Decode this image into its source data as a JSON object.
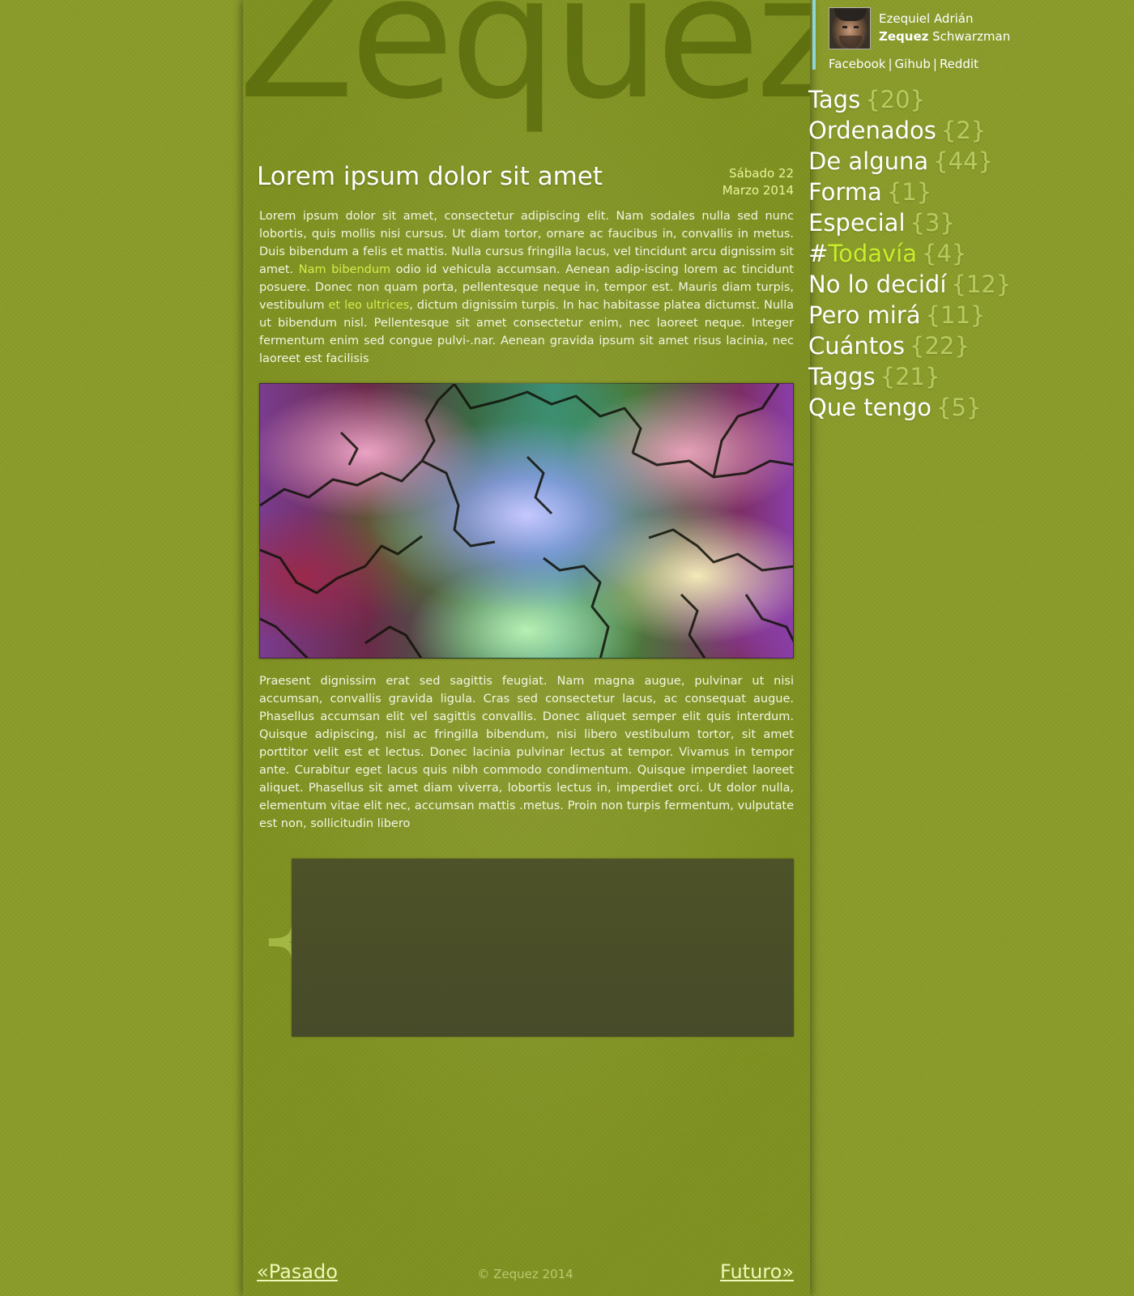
{
  "site": {
    "brand": "Zequez"
  },
  "post": {
    "title": "Lorem ipsum dolor sit amet",
    "date_line1": "Sábado 22",
    "date_line2": "Marzo 2014",
    "paragraph1": {
      "part1": "Lorem ipsum dolor sit amet, consectetur adipiscing elit. Nam sodales nulla sed nunc lobortis, quis mollis nisi cursus. Ut diam tortor, ornare ac faucibus in, convallis in metus. Duis bibendum a felis et mattis. Nulla cursus fringilla lacus, vel tincidunt arcu dignissim sit amet. ",
      "link1": "Nam bibendum",
      "part2": " odio id vehicula accumsan. Aenean adip-iscing lorem ac tincidunt posuere. Donec non quam porta, pellentesque neque in, tempor est. Mauris diam turpis, vestibulum ",
      "link2": "et leo ultrices",
      "part3": ", dictum dignissim turpis. In hac habitasse platea dictumst. Nulla ut bibendum nisl. Pellentesque sit amet consectetur enim, nec laoreet neque. Integer fermentum enim sed congue pulvi-.nar. Aenean gravida ipsum sit amet risus lacinia, nec laoreet est facilisis"
    },
    "paragraph2": "Praesent dignissim erat sed sagittis feugiat. Nam magna augue, pulvinar ut nisi accumsan, convallis gravida ligula. Cras sed consectetur lacus, ac consequat augue. Phasellus accumsan elit vel sagittis convallis. Donec aliquet semper elit quis interdum. Quisque adipiscing, nisl ac fringilla bibendum, nisi libero vestibulum tortor, sit amet porttitor velit est et lectus. Donec lacinia pulvinar lectus at tempor. Vivamus in tempor ante. Curabitur eget lacus quis nibh commodo condimentum. Quisque imperdiet laoreet aliquet. Phasellus sit amet diam viverra, lobortis lectus in, imperdiet orci. Ut dolor nulla, elementum vitae elit nec, accumsan mattis .metus. Proin non turpis fermentum, vulputate est non, sollicitudin libero",
    "embed_brace": "{"
  },
  "pager": {
    "prev_arrow": "«",
    "prev_label": "Pasado",
    "next_label": "Futuro",
    "next_arrow": "»",
    "copyright": "© Zequez 2014"
  },
  "profile": {
    "name_line1": "Ezequiel Adrián",
    "name_bold": "Zequez",
    "name_rest": " Schwarzman",
    "links": [
      "Facebook",
      "Gihub",
      "Reddit"
    ],
    "separator": "|"
  },
  "tags": [
    {
      "label": "Tags",
      "count": "{20}"
    },
    {
      "label": "Ordenados",
      "count": "{2}"
    },
    {
      "label": "De alguna",
      "count": "{44}"
    },
    {
      "label": "Forma",
      "count": "{1}"
    },
    {
      "label": "Especial",
      "count": "{3}"
    },
    {
      "hash": "#",
      "label": "Todavía",
      "count": "{4}",
      "active": true
    },
    {
      "label": "No lo decidí",
      "count": "{12}"
    },
    {
      "label": "Pero mirá",
      "count": "{11}"
    },
    {
      "label": "Cuántos",
      "count": "{22}"
    },
    {
      "label": "Taggs",
      "count": "{21}"
    },
    {
      "label": "Que tengo",
      "count": "{5}"
    }
  ],
  "colors": {
    "background": "#8a9b2a",
    "column": "#7f9120",
    "link_accent": "#d4ec4a",
    "active_tag": "#c8ee2a",
    "profile_bar": "#8fd4d8",
    "embed_box": "#4a4f28"
  }
}
